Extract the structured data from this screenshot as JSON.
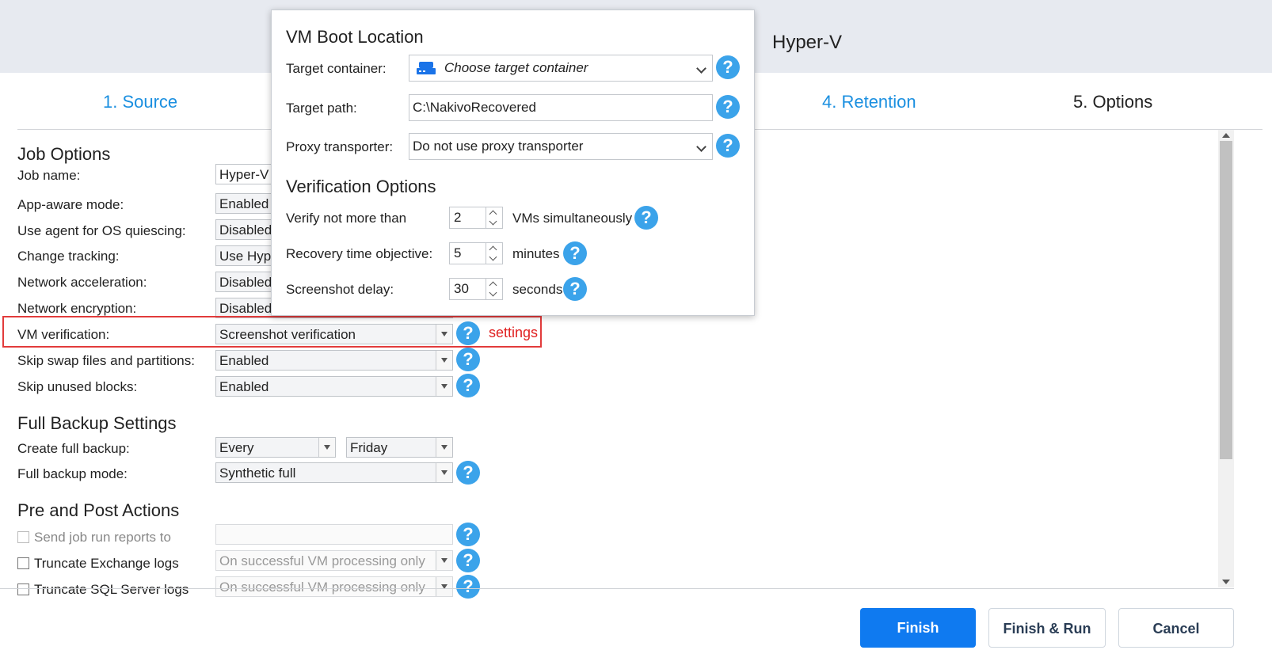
{
  "header": {
    "title": "Hyper-V"
  },
  "tabs": [
    {
      "label": "1. Source",
      "state": "link"
    },
    {
      "label": "4. Retention",
      "state": "link"
    },
    {
      "label": "5. Options",
      "state": "current"
    }
  ],
  "sections": {
    "job_options": "Job Options",
    "full_backup": "Full Backup Settings",
    "pre_post": "Pre and Post Actions"
  },
  "options": [
    {
      "label": "Job name:",
      "value": "Hyper-V"
    },
    {
      "label": "App-aware mode:",
      "value": "Enabled"
    },
    {
      "label": "Use agent for OS quiescing:",
      "value": "Disabled"
    },
    {
      "label": "Change tracking:",
      "value": "Use Hyp"
    },
    {
      "label": "Network acceleration:",
      "value": "Disabled"
    },
    {
      "label": "Network encryption:",
      "value": "Disabled"
    },
    {
      "label": "VM verification:",
      "value": "Screenshot verification",
      "link": "settings"
    },
    {
      "label": "Skip swap files and partitions:",
      "value": "Enabled"
    },
    {
      "label": "Skip unused blocks:",
      "value": "Enabled"
    }
  ],
  "full_backup": {
    "create_label": "Create full backup:",
    "create_value": "Every",
    "create_day": "Friday",
    "mode_label": "Full backup mode:",
    "mode_value": "Synthetic full"
  },
  "pre_post": {
    "send_reports_label": "Send job run reports to",
    "send_reports_value": "",
    "truncate_exchange_label": "Truncate Exchange logs",
    "truncate_exchange_value": "On successful VM processing only",
    "truncate_sql_label": "Truncate SQL Server logs",
    "truncate_sql_value": "On successful VM processing only"
  },
  "popup": {
    "heading": "VM Boot Location",
    "target_container_label": "Target container:",
    "target_container_value": "Choose target container",
    "target_path_label": "Target path:",
    "target_path_value": "C:\\NakivoRecovered",
    "proxy_label": "Proxy transporter:",
    "proxy_value": "Do not use proxy transporter",
    "verification_heading": "Verification Options",
    "verify_label": "Verify not more than",
    "verify_value": "2",
    "verify_unit": "VMs simultaneously",
    "rto_label": "Recovery time objective:",
    "rto_value": "5",
    "rto_unit": "minutes",
    "delay_label": "Screenshot delay:",
    "delay_value": "30",
    "delay_unit": "seconds"
  },
  "help_glyph": "?",
  "footer": {
    "finish": "Finish",
    "finish_run": "Finish & Run",
    "cancel": "Cancel"
  },
  "colors": {
    "accent": "#0f7af0",
    "link": "#1a8fe0",
    "help": "#3ba3ea",
    "highlight": "#e23b3b"
  }
}
